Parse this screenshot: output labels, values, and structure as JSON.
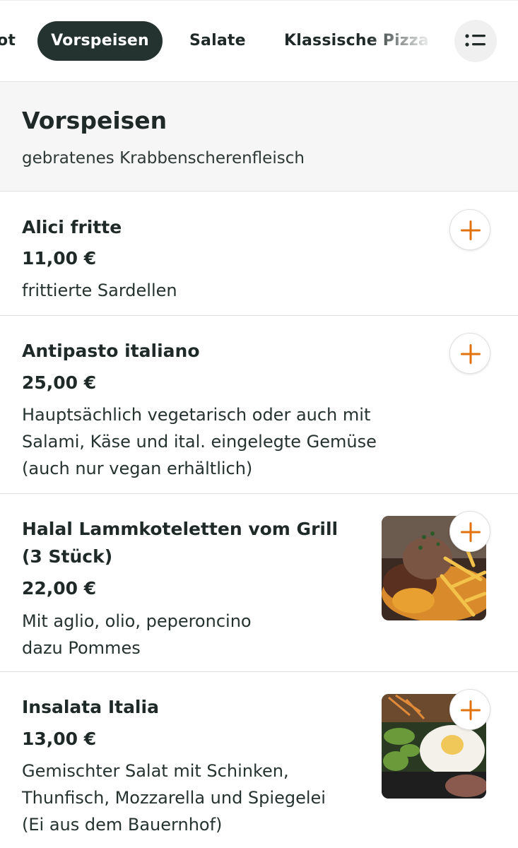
{
  "tabs": [
    {
      "label": "ot"
    },
    {
      "label": "Vorspeisen"
    },
    {
      "label": "Salate"
    },
    {
      "label": "Klassische Pizza"
    }
  ],
  "category": {
    "title": "Vorspeisen",
    "description": "gebratenes Krabbenscherenfleisch"
  },
  "items": [
    {
      "name": "Alici fritte",
      "price": "11,00 €",
      "desc_lines": [
        "frittierte Sardellen"
      ]
    },
    {
      "name": "Antipasto italiano",
      "price": "25,00 €",
      "desc_lines": [
        "Hauptsächlich vegetarisch oder auch mit",
        "Salami, Käse und ital. eingelegte Gemüse",
        "(auch nur vegan erhältlich)"
      ]
    },
    {
      "name_lines": [
        "Halal Lammkoteletten vom Grill",
        "(3 Stück)"
      ],
      "price": "22,00 €",
      "desc_lines": [
        "Mit aglio, olio, peperoncino",
        "dazu Pommes"
      ]
    },
    {
      "name": "Insalata Italia",
      "price": "13,00 €",
      "desc_lines": [
        "Gemischter Salat mit Schinken,",
        "Thunfisch, Mozzarella und Spiegelei",
        "(Ei aus dem Bauernhof)"
      ]
    }
  ],
  "colors": {
    "accent": "#e2720e",
    "active_tab_bg": "#243230"
  },
  "icons": {
    "menu": "list-icon",
    "add": "plus-icon"
  }
}
